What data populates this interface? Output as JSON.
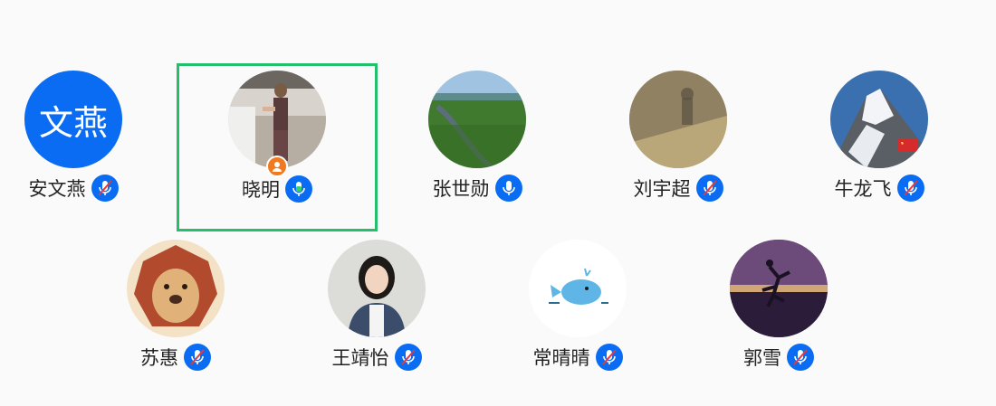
{
  "participants": [
    {
      "name": "安文燕",
      "avatar_text": "文燕",
      "mic": "muted"
    },
    {
      "name": "晓明",
      "mic": "speaking",
      "host": true,
      "selected": true
    },
    {
      "name": "张世勋",
      "mic": "on"
    },
    {
      "name": "刘宇超",
      "mic": "muted"
    },
    {
      "name": "牛龙飞",
      "mic": "muted"
    },
    {
      "name": "苏惠",
      "mic": "muted"
    },
    {
      "name": "王靖怡",
      "mic": "muted"
    },
    {
      "name": "常晴晴",
      "mic": "muted"
    },
    {
      "name": "郭雪",
      "mic": "muted"
    }
  ],
  "colors": {
    "accent": "#0a6cf2",
    "selected_border": "#22c06a",
    "host_badge": "#f07a1d",
    "speaking": "#36d16b"
  }
}
